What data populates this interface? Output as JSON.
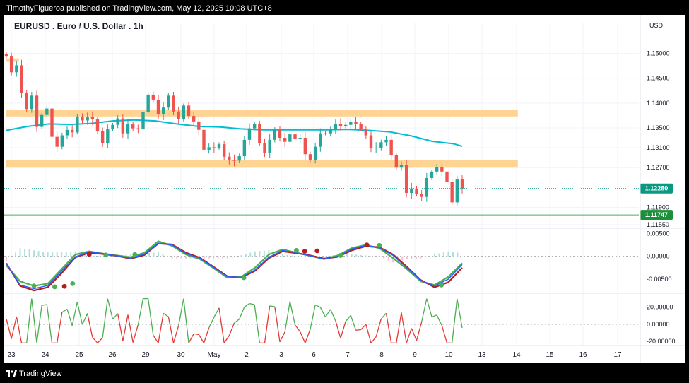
{
  "header": {
    "published_line": "TimothyFigueroa published on TradingView.com, May 12, 2025 10:08 UTC+8"
  },
  "footer": {
    "brand_label": "TradingView"
  },
  "colors": {
    "up": "#26a69a",
    "down": "#ef5350",
    "zone": "#ffcc80",
    "ema": "#00bcd4",
    "price_badge": "#089981",
    "level_badge": "#1b8f3a",
    "level_line": "#4caf50",
    "wave_fast": "#4caf50",
    "wave_slow": "#b71c1c",
    "wave_signal": "#2962ff",
    "osc_up": "#4caf50",
    "osc_down": "#e53935",
    "hist_up": "#b2dfdb",
    "hist_down": "#f8bbd0"
  },
  "chart_data": [
    {
      "type": "candlestick",
      "title": "EURUSD . Euro / U.S. Dollar . 1h",
      "currency_label": "USD",
      "interval": "1h",
      "y_ticks": [
        "1.15000",
        "1.14500",
        "1.14000",
        "1.13500",
        "1.13100",
        "1.12700",
        "1.11900",
        "1.11550"
      ],
      "ylim": [
        1.1155,
        1.1535
      ],
      "x_labels": [
        "23",
        "24",
        "25",
        "26",
        "29",
        "30",
        "May",
        "2",
        "3",
        "6",
        "7",
        "8",
        "9",
        "10",
        "13",
        "14",
        "15",
        "16",
        "17"
      ],
      "last_price": "1.12280",
      "level_price": "1.11747",
      "ema_line": {
        "color": "#00bcd4",
        "points": [
          [
            0,
            1.1345
          ],
          [
            5,
            1.1353
          ],
          [
            10,
            1.1358
          ],
          [
            15,
            1.1357
          ],
          [
            20,
            1.1359
          ],
          [
            25,
            1.1364
          ],
          [
            30,
            1.1366
          ],
          [
            35,
            1.1364
          ],
          [
            40,
            1.1358
          ],
          [
            45,
            1.1353
          ],
          [
            50,
            1.1352
          ],
          [
            55,
            1.1348
          ],
          [
            60,
            1.1346
          ],
          [
            65,
            1.1346
          ],
          [
            70,
            1.1346
          ],
          [
            75,
            1.1346
          ],
          [
            80,
            1.1347
          ],
          [
            85,
            1.1345
          ],
          [
            90,
            1.1342
          ],
          [
            95,
            1.1334
          ],
          [
            100,
            1.1323
          ],
          [
            105,
            1.1318
          ],
          [
            107,
            1.1313
          ]
        ]
      },
      "zones": [
        {
          "from": 0,
          "to": 2.5,
          "top": 1.149,
          "bottom": 1.1483
        },
        {
          "from": 0,
          "to": 101,
          "top": 1.1387,
          "bottom": 1.1373
        },
        {
          "from": 0,
          "to": 101,
          "top": 1.1285,
          "bottom": 1.127
        }
      ],
      "candles_close": [
        1.1495,
        1.1462,
        1.1476,
        1.1421,
        1.1388,
        1.1415,
        1.1352,
        1.1376,
        1.1389,
        1.1332,
        1.1312,
        1.1335,
        1.1346,
        1.1341,
        1.1373,
        1.1365,
        1.1372,
        1.1367,
        1.1343,
        1.1319,
        1.1347,
        1.1356,
        1.1369,
        1.1339,
        1.1357,
        1.1349,
        1.1347,
        1.1382,
        1.1417,
        1.1407,
        1.1377,
        1.1391,
        1.1415,
        1.1383,
        1.1367,
        1.1395,
        1.1374,
        1.1363,
        1.1346,
        1.1306,
        1.1311,
        1.131,
        1.1317,
        1.1292,
        1.1285,
        1.1284,
        1.1293,
        1.1326,
        1.1349,
        1.1358,
        1.132,
        1.13,
        1.1326,
        1.1346,
        1.133,
        1.1322,
        1.1337,
        1.1328,
        1.133,
        1.1297,
        1.1286,
        1.1312,
        1.1339,
        1.1339,
        1.1346,
        1.1358,
        1.1354,
        1.1356,
        1.1362,
        1.1358,
        1.1348,
        1.1335,
        1.131,
        1.131,
        1.1321,
        1.1326,
        1.1295,
        1.127,
        1.1276,
        1.1219,
        1.1228,
        1.1217,
        1.1211,
        1.1249,
        1.1262,
        1.1271,
        1.1262,
        1.1241,
        1.12,
        1.1246,
        1.1228
      ]
    },
    {
      "type": "line",
      "y_ticks": [
        "0.00500",
        "0.00000",
        "-0.00500"
      ],
      "ylim": [
        -0.0078,
        0.0057
      ],
      "series": [
        {
          "color": "#4caf50",
          "values": [
            -0.002,
            -0.0055,
            -0.0065,
            -0.006,
            -0.0028,
            0.0004,
            0.0011,
            0.0006,
            0.0002,
            -0.0002,
            0.0008,
            0.0033,
            0.0023,
            0.0004,
            -0.0006,
            -0.0026,
            -0.0047,
            -0.0045,
            -0.0025,
            0.0004,
            0.0015,
            0.0008,
            0.0001,
            -0.0006,
            0.0002,
            0.0018,
            0.0025,
            0.0018,
            -0.0004,
            -0.0028,
            -0.0055,
            -0.0063,
            -0.0045,
            -0.0015
          ]
        },
        {
          "color": "#b71c1c",
          "values": [
            -0.0015,
            -0.0065,
            -0.0075,
            -0.0068,
            -0.0037,
            -0.0002,
            0.0008,
            0.0005,
            0.0001,
            -0.0005,
            0.0003,
            0.0028,
            0.0026,
            0.0008,
            -0.0003,
            -0.0023,
            -0.0044,
            -0.0047,
            -0.0032,
            -0.0004,
            0.0011,
            0.0007,
            0.0002,
            -0.0005,
            -0.0001,
            0.0013,
            0.0022,
            0.002,
            0.0004,
            -0.0023,
            -0.0052,
            -0.0068,
            -0.0057,
            -0.0025
          ]
        },
        {
          "color": "#2962ff",
          "values": [
            -0.0015,
            -0.0063,
            -0.0071,
            -0.0064,
            -0.0032,
            -0.0001,
            0.001,
            0.0006,
            0.0001,
            -0.0004,
            0.0005,
            0.0029,
            0.0025,
            0.0006,
            -0.0004,
            -0.0024,
            -0.0045,
            -0.0046,
            -0.003,
            -0.0002,
            0.0013,
            0.0008,
            0.0001,
            -0.0006,
            0.0,
            0.0016,
            0.0024,
            0.0019,
            0.0002,
            -0.0025,
            -0.0053,
            -0.0065,
            -0.005,
            -0.0018
          ]
        }
      ],
      "crossover_dots": [
        {
          "x": 2.0,
          "value": -0.0065,
          "color": "#4caf50"
        },
        {
          "x": 3.5,
          "value": -0.0067,
          "color": "#4caf50"
        },
        {
          "x": 4.2,
          "value": -0.0066,
          "color": "#b71c1c"
        },
        {
          "x": 4.8,
          "value": -0.006,
          "color": "#4caf50"
        },
        {
          "x": 6.0,
          "value": 0.0004,
          "color": "#b71c1c"
        },
        {
          "x": 7.2,
          "value": 0.0003,
          "color": "#4caf50"
        },
        {
          "x": 9.3,
          "value": 0.0004,
          "color": "#4caf50"
        },
        {
          "x": 17.2,
          "value": -0.0047,
          "color": "#4caf50"
        },
        {
          "x": 21.0,
          "value": 0.0013,
          "color": "#4caf50"
        },
        {
          "x": 21.6,
          "value": 0.0011,
          "color": "#b71c1c"
        },
        {
          "x": 22.5,
          "value": 0.0012,
          "color": "#b71c1c"
        },
        {
          "x": 24.2,
          "value": 0.0002,
          "color": "#4caf50"
        },
        {
          "x": 26.1,
          "value": 0.0025,
          "color": "#b71c1c"
        },
        {
          "x": 27.0,
          "value": 0.0024,
          "color": "#4caf50"
        },
        {
          "x": 31.5,
          "value": -0.0063,
          "color": "#4caf50"
        }
      ]
    },
    {
      "type": "line",
      "y_ticks": [
        "20.00000",
        "0.00000",
        "-20.00000"
      ],
      "ylim": [
        -25,
        33
      ],
      "threshold": 0
    }
  ]
}
